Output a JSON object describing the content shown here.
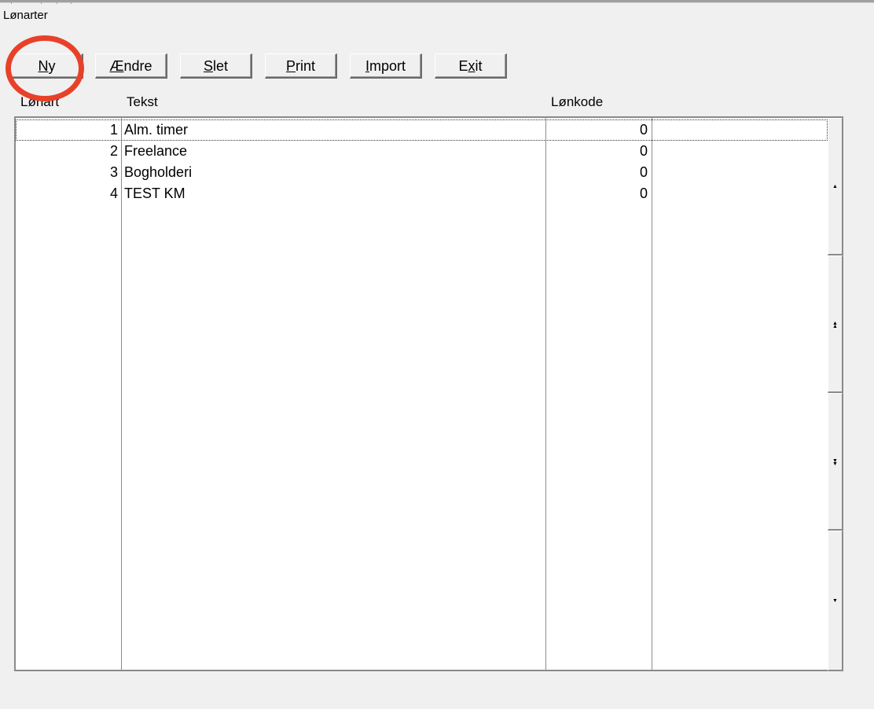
{
  "window": {
    "title": "Lønarter"
  },
  "toolbar": {
    "buttons": [
      {
        "underline": "N",
        "rest": "y"
      },
      {
        "underline": "Æ",
        "rest": "ndre"
      },
      {
        "underline": "S",
        "rest": "let"
      },
      {
        "underline": "P",
        "rest": "rint"
      },
      {
        "underline": "I",
        "rest": "mport"
      },
      {
        "pre": "E",
        "underline": "x",
        "rest": "it"
      }
    ]
  },
  "table": {
    "columns": [
      "Lønart",
      "Tekst",
      "Lønkode"
    ],
    "rows": [
      {
        "lonart": "1",
        "tekst": "Alm. timer",
        "lonkode": "0"
      },
      {
        "lonart": "2",
        "tekst": "Freelance",
        "lonkode": "0"
      },
      {
        "lonart": "3",
        "tekst": "Bogholderi",
        "lonkode": "0"
      },
      {
        "lonart": "4",
        "tekst": "TEST KM",
        "lonkode": "0"
      }
    ]
  },
  "scrollbar": {
    "buttons": [
      "▲",
      "▲▲",
      "▼▼",
      "▼"
    ]
  },
  "highlight": {
    "color": "#e8412a"
  }
}
